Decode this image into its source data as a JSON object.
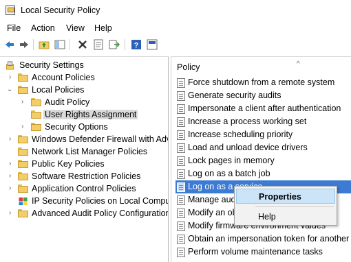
{
  "window": {
    "title": "Local Security Policy"
  },
  "menu": [
    "File",
    "Action",
    "View",
    "Help"
  ],
  "toolbar": {
    "icons": [
      "back-arrow-icon",
      "forward-arrow-icon",
      "up-folder-icon",
      "show-hide-tree-icon",
      "delete-icon",
      "properties-icon",
      "export-list-icon",
      "help-icon",
      "console-icon"
    ]
  },
  "tree": {
    "items": [
      {
        "label": "Security Settings",
        "level": 0,
        "expanded": true
      },
      {
        "label": "Account Policies",
        "level": 1,
        "expanded": false
      },
      {
        "label": "Local Policies",
        "level": 1,
        "expanded": true
      },
      {
        "label": "Audit Policy",
        "level": 2,
        "expanded": false
      },
      {
        "label": "User Rights Assignment",
        "level": 2,
        "selected": true
      },
      {
        "label": "Security Options",
        "level": 2,
        "expanded": false
      },
      {
        "label": "Windows Defender Firewall with Adva",
        "level": 1,
        "expanded": false
      },
      {
        "label": "Network List Manager Policies",
        "level": 1
      },
      {
        "label": "Public Key Policies",
        "level": 1,
        "expanded": false
      },
      {
        "label": "Software Restriction Policies",
        "level": 1,
        "expanded": false
      },
      {
        "label": "Application Control Policies",
        "level": 1,
        "expanded": false
      },
      {
        "label": "IP Security Policies on Local Compute",
        "level": 1
      },
      {
        "label": "Advanced Audit Policy Configuration",
        "level": 1,
        "expanded": false
      }
    ]
  },
  "list": {
    "header": "Policy",
    "rows": [
      "Force shutdown from a remote system",
      "Generate security audits",
      "Impersonate a client after authentication",
      "Increase a process working set",
      "Increase scheduling priority",
      "Load and unload device drivers",
      "Lock pages in memory",
      "Log on as a batch job",
      "Log on as a service",
      "Manage aud",
      "Modify an ob",
      "Modify firmware environment values",
      "Obtain an impersonation token for another u",
      "Perform volume maintenance tasks"
    ],
    "selected_index": 8
  },
  "context_menu": {
    "items": [
      {
        "label": "Properties",
        "bold": true,
        "hover": true
      },
      {
        "label": "Help"
      }
    ]
  },
  "colors": {
    "selection": "#3b7bd4",
    "menu_hover": "#cce4f7",
    "folder": "#f3cd6a"
  }
}
